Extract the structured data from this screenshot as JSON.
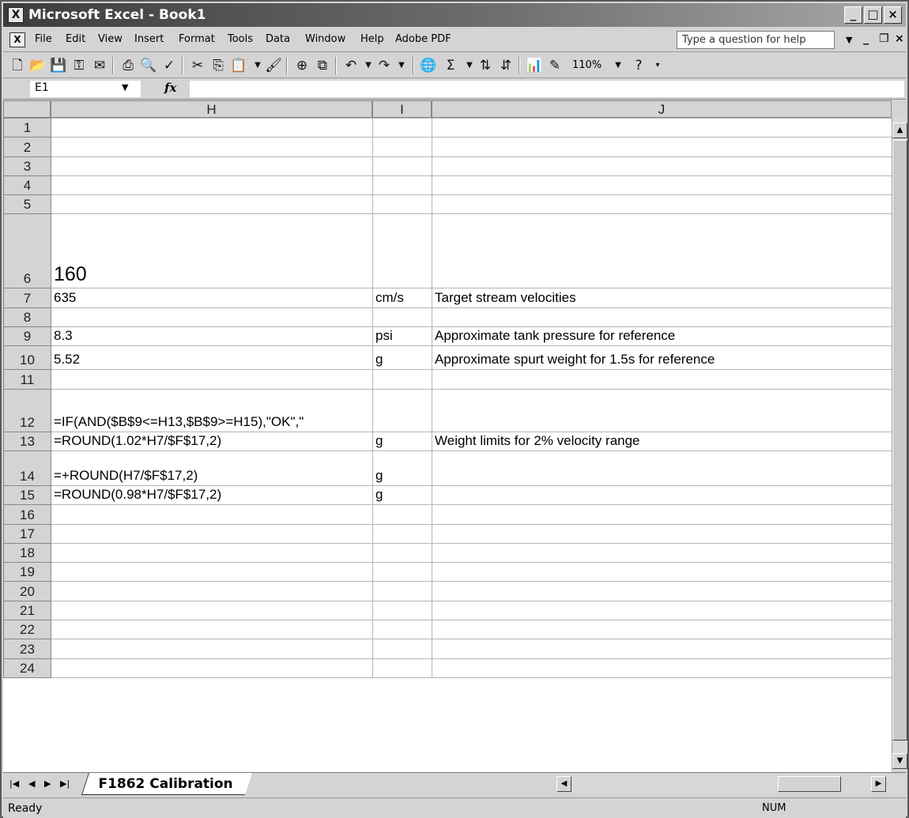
{
  "window": {
    "title": "Microsoft Excel - Book1"
  },
  "menu": {
    "items": [
      "File",
      "Edit",
      "View",
      "Insert",
      "Format",
      "Tools",
      "Data",
      "Window",
      "Help",
      "Adobe PDF"
    ],
    "help_placeholder": "Type a question for help"
  },
  "toolbar": {
    "zoom": "110%"
  },
  "formula_bar": {
    "name_box": "E1",
    "fx_label": "fx",
    "formula": ""
  },
  "columns": [
    "H",
    "I",
    "J"
  ],
  "rows": [
    {
      "num": "1",
      "H": "",
      "I": "",
      "J": ""
    },
    {
      "num": "2",
      "H": "",
      "I": "",
      "J": ""
    },
    {
      "num": "3",
      "H": "",
      "I": "",
      "J": ""
    },
    {
      "num": "4",
      "H": "",
      "I": "",
      "J": ""
    },
    {
      "num": "5",
      "H": "",
      "I": "",
      "J": ""
    },
    {
      "num": "6",
      "H": "160",
      "I": "",
      "J": ""
    },
    {
      "num": "7",
      "H": "635",
      "I": "cm/s",
      "J": "Target stream velocities"
    },
    {
      "num": "8",
      "H": "",
      "I": "",
      "J": ""
    },
    {
      "num": "9",
      "H": "8.3",
      "I": "psi",
      "J": "Approximate tank pressure for reference"
    },
    {
      "num": "10",
      "H": "5.52",
      "I": "g",
      "J": "Approximate spurt weight for 1.5s for reference"
    },
    {
      "num": "11",
      "H": "",
      "I": "",
      "J": ""
    },
    {
      "num": "12",
      "H": "=IF(AND($B$9<=H13,$B$9>=H15),\"OK\",\"",
      "I": "",
      "J": ""
    },
    {
      "num": "13",
      "H": "=ROUND(1.02*H7/$F$17,2)",
      "I": "g",
      "J": "Weight limits for 2% velocity range"
    },
    {
      "num": "14",
      "H": "=+ROUND(H7/$F$17,2)",
      "I": "g",
      "J": ""
    },
    {
      "num": "15",
      "H": "=ROUND(0.98*H7/$F$17,2)",
      "I": "g",
      "J": ""
    },
    {
      "num": "16",
      "H": "",
      "I": "",
      "J": ""
    },
    {
      "num": "17",
      "H": "",
      "I": "",
      "J": ""
    },
    {
      "num": "18",
      "H": "",
      "I": "",
      "J": ""
    },
    {
      "num": "19",
      "H": "",
      "I": "",
      "J": ""
    },
    {
      "num": "20",
      "H": "",
      "I": "",
      "J": ""
    },
    {
      "num": "21",
      "H": "",
      "I": "",
      "J": ""
    },
    {
      "num": "22",
      "H": "",
      "I": "",
      "J": ""
    },
    {
      "num": "23",
      "H": "",
      "I": "",
      "J": ""
    },
    {
      "num": "24",
      "H": "",
      "I": "",
      "J": ""
    }
  ],
  "sheet_tabs": [
    "F1862 Calibration"
  ],
  "status": {
    "left": "Ready",
    "num": "NUM"
  }
}
